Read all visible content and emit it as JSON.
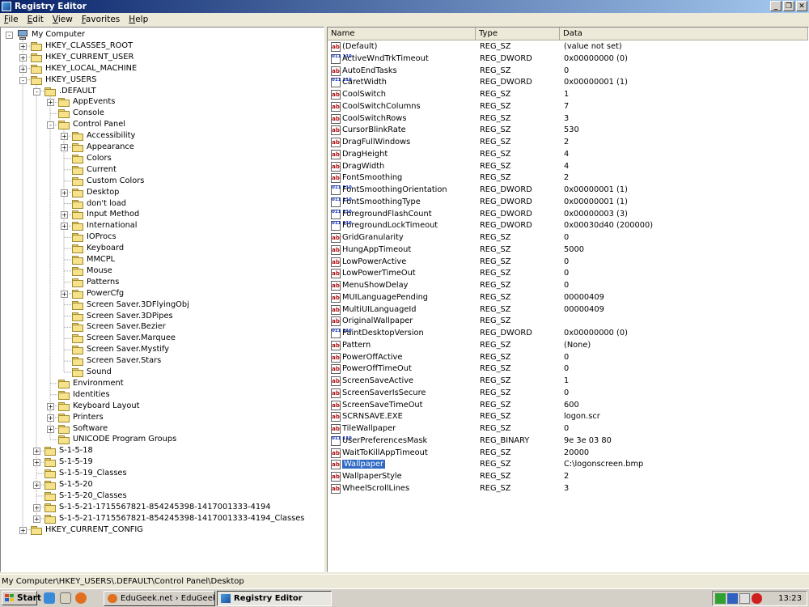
{
  "window": {
    "title": "Registry Editor",
    "buttons": [
      "_",
      "❐",
      "✕"
    ]
  },
  "menu": [
    {
      "key": "F",
      "rest": "ile"
    },
    {
      "key": "E",
      "rest": "dit"
    },
    {
      "key": "V",
      "rest": "iew"
    },
    {
      "key": "F",
      "rest": "avorites",
      "prefix": "",
      "full": "Favorites"
    },
    {
      "key": "H",
      "rest": "elp"
    }
  ],
  "tree": [
    {
      "label": "My Computer",
      "level": 0,
      "exp": "-",
      "icon": "computer-icon"
    },
    {
      "label": "HKEY_CLASSES_ROOT",
      "level": 1,
      "exp": "+"
    },
    {
      "label": "HKEY_CURRENT_USER",
      "level": 1,
      "exp": "+"
    },
    {
      "label": "HKEY_LOCAL_MACHINE",
      "level": 1,
      "exp": "+"
    },
    {
      "label": "HKEY_USERS",
      "level": 1,
      "exp": "-"
    },
    {
      "label": ".DEFAULT",
      "level": 2,
      "exp": "-"
    },
    {
      "label": "AppEvents",
      "level": 3,
      "exp": "+"
    },
    {
      "label": "Console",
      "level": 3,
      "exp": ""
    },
    {
      "label": "Control Panel",
      "level": 3,
      "exp": "-"
    },
    {
      "label": "Accessibility",
      "level": 4,
      "exp": "+"
    },
    {
      "label": "Appearance",
      "level": 4,
      "exp": "+"
    },
    {
      "label": "Colors",
      "level": 4,
      "exp": ""
    },
    {
      "label": "Current",
      "level": 4,
      "exp": ""
    },
    {
      "label": "Custom Colors",
      "level": 4,
      "exp": ""
    },
    {
      "label": "Desktop",
      "level": 4,
      "exp": "+",
      "open": true
    },
    {
      "label": "don't load",
      "level": 4,
      "exp": ""
    },
    {
      "label": "Input Method",
      "level": 4,
      "exp": "+"
    },
    {
      "label": "International",
      "level": 4,
      "exp": "+"
    },
    {
      "label": "IOProcs",
      "level": 4,
      "exp": ""
    },
    {
      "label": "Keyboard",
      "level": 4,
      "exp": ""
    },
    {
      "label": "MMCPL",
      "level": 4,
      "exp": ""
    },
    {
      "label": "Mouse",
      "level": 4,
      "exp": ""
    },
    {
      "label": "Patterns",
      "level": 4,
      "exp": ""
    },
    {
      "label": "PowerCfg",
      "level": 4,
      "exp": "+"
    },
    {
      "label": "Screen Saver.3DFlyingObj",
      "level": 4,
      "exp": ""
    },
    {
      "label": "Screen Saver.3DPipes",
      "level": 4,
      "exp": ""
    },
    {
      "label": "Screen Saver.Bezier",
      "level": 4,
      "exp": ""
    },
    {
      "label": "Screen Saver.Marquee",
      "level": 4,
      "exp": ""
    },
    {
      "label": "Screen Saver.Mystify",
      "level": 4,
      "exp": ""
    },
    {
      "label": "Screen Saver.Stars",
      "level": 4,
      "exp": ""
    },
    {
      "label": "Sound",
      "level": 4,
      "exp": ""
    },
    {
      "label": "Environment",
      "level": 3,
      "exp": ""
    },
    {
      "label": "Identities",
      "level": 3,
      "exp": ""
    },
    {
      "label": "Keyboard Layout",
      "level": 3,
      "exp": "+"
    },
    {
      "label": "Printers",
      "level": 3,
      "exp": "+"
    },
    {
      "label": "Software",
      "level": 3,
      "exp": "+"
    },
    {
      "label": "UNICODE Program Groups",
      "level": 3,
      "exp": ""
    },
    {
      "label": "S-1-5-18",
      "level": 2,
      "exp": "+"
    },
    {
      "label": "S-1-5-19",
      "level": 2,
      "exp": "+"
    },
    {
      "label": "S-1-5-19_Classes",
      "level": 2,
      "exp": ""
    },
    {
      "label": "S-1-5-20",
      "level": 2,
      "exp": "+"
    },
    {
      "label": "S-1-5-20_Classes",
      "level": 2,
      "exp": ""
    },
    {
      "label": "S-1-5-21-1715567821-854245398-1417001333-4194",
      "level": 2,
      "exp": "+"
    },
    {
      "label": "S-1-5-21-1715567821-854245398-1417001333-4194_Classes",
      "level": 2,
      "exp": "+"
    },
    {
      "label": "HKEY_CURRENT_CONFIG",
      "level": 1,
      "exp": "+"
    }
  ],
  "columns": [
    "Name",
    "Type",
    "Data"
  ],
  "values": [
    {
      "name": "(Default)",
      "type": "REG_SZ",
      "data": "(value not set)"
    },
    {
      "name": "ActiveWndTrkTimeout",
      "type": "REG_DWORD",
      "data": "0x00000000 (0)"
    },
    {
      "name": "AutoEndTasks",
      "type": "REG_SZ",
      "data": "0"
    },
    {
      "name": "CaretWidth",
      "type": "REG_DWORD",
      "data": "0x00000001 (1)"
    },
    {
      "name": "CoolSwitch",
      "type": "REG_SZ",
      "data": "1"
    },
    {
      "name": "CoolSwitchColumns",
      "type": "REG_SZ",
      "data": "7"
    },
    {
      "name": "CoolSwitchRows",
      "type": "REG_SZ",
      "data": "3"
    },
    {
      "name": "CursorBlinkRate",
      "type": "REG_SZ",
      "data": "530"
    },
    {
      "name": "DragFullWindows",
      "type": "REG_SZ",
      "data": "2"
    },
    {
      "name": "DragHeight",
      "type": "REG_SZ",
      "data": "4"
    },
    {
      "name": "DragWidth",
      "type": "REG_SZ",
      "data": "4"
    },
    {
      "name": "FontSmoothing",
      "type": "REG_SZ",
      "data": "2"
    },
    {
      "name": "FontSmoothingOrientation",
      "type": "REG_DWORD",
      "data": "0x00000001 (1)"
    },
    {
      "name": "FontSmoothingType",
      "type": "REG_DWORD",
      "data": "0x00000001 (1)"
    },
    {
      "name": "ForegroundFlashCount",
      "type": "REG_DWORD",
      "data": "0x00000003 (3)"
    },
    {
      "name": "ForegroundLockTimeout",
      "type": "REG_DWORD",
      "data": "0x00030d40 (200000)"
    },
    {
      "name": "GridGranularity",
      "type": "REG_SZ",
      "data": "0"
    },
    {
      "name": "HungAppTimeout",
      "type": "REG_SZ",
      "data": "5000"
    },
    {
      "name": "LowPowerActive",
      "type": "REG_SZ",
      "data": "0"
    },
    {
      "name": "LowPowerTimeOut",
      "type": "REG_SZ",
      "data": "0"
    },
    {
      "name": "MenuShowDelay",
      "type": "REG_SZ",
      "data": "0"
    },
    {
      "name": "MUILanguagePending",
      "type": "REG_SZ",
      "data": "00000409"
    },
    {
      "name": "MultiUILanguageId",
      "type": "REG_SZ",
      "data": "00000409"
    },
    {
      "name": "OriginalWallpaper",
      "type": "REG_SZ",
      "data": ""
    },
    {
      "name": "PaintDesktopVersion",
      "type": "REG_DWORD",
      "data": "0x00000000 (0)"
    },
    {
      "name": "Pattern",
      "type": "REG_SZ",
      "data": "(None)"
    },
    {
      "name": "PowerOffActive",
      "type": "REG_SZ",
      "data": "0"
    },
    {
      "name": "PowerOffTimeOut",
      "type": "REG_SZ",
      "data": "0"
    },
    {
      "name": "ScreenSaveActive",
      "type": "REG_SZ",
      "data": "1"
    },
    {
      "name": "ScreenSaverIsSecure",
      "type": "REG_SZ",
      "data": "0"
    },
    {
      "name": "ScreenSaveTimeOut",
      "type": "REG_SZ",
      "data": "600"
    },
    {
      "name": "SCRNSAVE.EXE",
      "type": "REG_SZ",
      "data": "logon.scr"
    },
    {
      "name": "TileWallpaper",
      "type": "REG_SZ",
      "data": "0"
    },
    {
      "name": "UserPreferencesMask",
      "type": "REG_BINARY",
      "data": "9e 3e 03 80"
    },
    {
      "name": "WaitToKillAppTimeout",
      "type": "REG_SZ",
      "data": "20000"
    },
    {
      "name": "Wallpaper",
      "type": "REG_SZ",
      "data": "C:\\logonscreen.bmp",
      "selected": true
    },
    {
      "name": "WallpaperStyle",
      "type": "REG_SZ",
      "data": "2"
    },
    {
      "name": "WheelScrollLines",
      "type": "REG_SZ",
      "data": "3"
    }
  ],
  "status": "My Computer\\HKEY_USERS\\.DEFAULT\\Control Panel\\Desktop",
  "taskbar": {
    "start": "Start",
    "tasks": [
      {
        "label": "EduGeek.net › EduGeek ...",
        "active": false
      },
      {
        "label": "Registry Editor",
        "active": true
      }
    ],
    "clock": "13:23"
  },
  "colors": {
    "selection": "#316ac5",
    "titlebar": "#0a246a"
  }
}
